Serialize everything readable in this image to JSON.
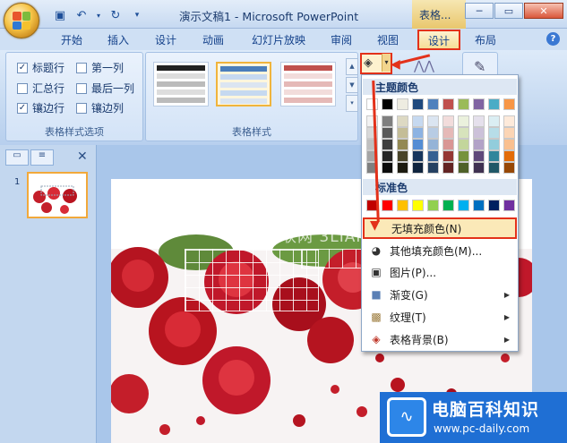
{
  "window": {
    "title": "演示文稿1 - Microsoft PowerPoint",
    "context_tab_title": "表格..."
  },
  "quick_access": [
    "save-icon",
    "undo-icon",
    "redo-icon",
    "customize-icon"
  ],
  "window_buttons": [
    "minimize",
    "maximize",
    "close"
  ],
  "tabs": [
    {
      "label": "开始"
    },
    {
      "label": "插入"
    },
    {
      "label": "设计"
    },
    {
      "label": "动画"
    },
    {
      "label": "幻灯片放映"
    },
    {
      "label": "审阅"
    },
    {
      "label": "视图"
    },
    {
      "label": "设计"
    },
    {
      "label": "布局"
    }
  ],
  "ribbon": {
    "style_options": {
      "label": "表格样式选项",
      "checkboxes": [
        {
          "label": "标题行",
          "checked": true
        },
        {
          "label": "第一列",
          "checked": false
        },
        {
          "label": "汇总行",
          "checked": false
        },
        {
          "label": "最后一列",
          "checked": false
        },
        {
          "label": "镶边行",
          "checked": true
        },
        {
          "label": "镶边列",
          "checked": false
        }
      ]
    },
    "table_styles": {
      "label": "表格样式",
      "thumb_colors": [
        "#333333",
        "#4a7ebb",
        "#c0504d"
      ]
    }
  },
  "slide_pane": {
    "slide_number": "1",
    "close_icon": "close-icon"
  },
  "menu": {
    "theme_colors_header": "主题颜色",
    "standard_colors_header": "标准色",
    "theme_top": [
      "#ffffff",
      "#000000",
      "#eeece1",
      "#1f497d",
      "#4f81bd",
      "#c0504d",
      "#9bbb59",
      "#8064a2",
      "#4bacc6",
      "#f79646"
    ],
    "theme_shades": [
      [
        "#f2f2f2",
        "#7f7f7f",
        "#ddd9c3",
        "#c6d9f0",
        "#dbe5f1",
        "#f2dcdb",
        "#ebf1dd",
        "#e5e0ec",
        "#dbeef3",
        "#fdeada"
      ],
      [
        "#d8d8d8",
        "#595959",
        "#c4bd97",
        "#8db3e2",
        "#b8cce4",
        "#e5b9b7",
        "#d7e3bc",
        "#ccc1d9",
        "#b7dde8",
        "#fbd5b5"
      ],
      [
        "#bfbfbf",
        "#3f3f3f",
        "#938953",
        "#548dd4",
        "#95b3d7",
        "#d99694",
        "#c3d69b",
        "#b2a2c7",
        "#92cddc",
        "#fac08f"
      ],
      [
        "#a5a5a5",
        "#262626",
        "#494429",
        "#17365d",
        "#366092",
        "#953734",
        "#76923c",
        "#5f497a",
        "#31859b",
        "#e36c09"
      ],
      [
        "#7f7f7f",
        "#0c0c0c",
        "#1d1b10",
        "#0f243e",
        "#244061",
        "#632423",
        "#4f6128",
        "#3f3151",
        "#205867",
        "#974806"
      ]
    ],
    "standard": [
      "#c00000",
      "#ff0000",
      "#ffc000",
      "#ffff00",
      "#92d050",
      "#00b050",
      "#00b0f0",
      "#0070c0",
      "#002060",
      "#7030a0"
    ],
    "items": [
      {
        "label": "无填充颜色(N)",
        "icon": "no-fill-icon",
        "submenu": false
      },
      {
        "label": "其他填充颜色(M)...",
        "icon": "palette-icon",
        "submenu": false
      },
      {
        "label": "图片(P)...",
        "icon": "picture-icon",
        "submenu": false
      },
      {
        "label": "渐变(G)",
        "icon": "gradient-icon",
        "submenu": true
      },
      {
        "label": "纹理(T)",
        "icon": "texture-icon",
        "submenu": true
      },
      {
        "label": "表格背景(B)",
        "icon": "table-background-icon",
        "submenu": true
      }
    ]
  },
  "watermark": "三联网 3LIAN.COM",
  "brand": {
    "name": "电脑百科知识",
    "url": "www.pc-daily.com"
  }
}
